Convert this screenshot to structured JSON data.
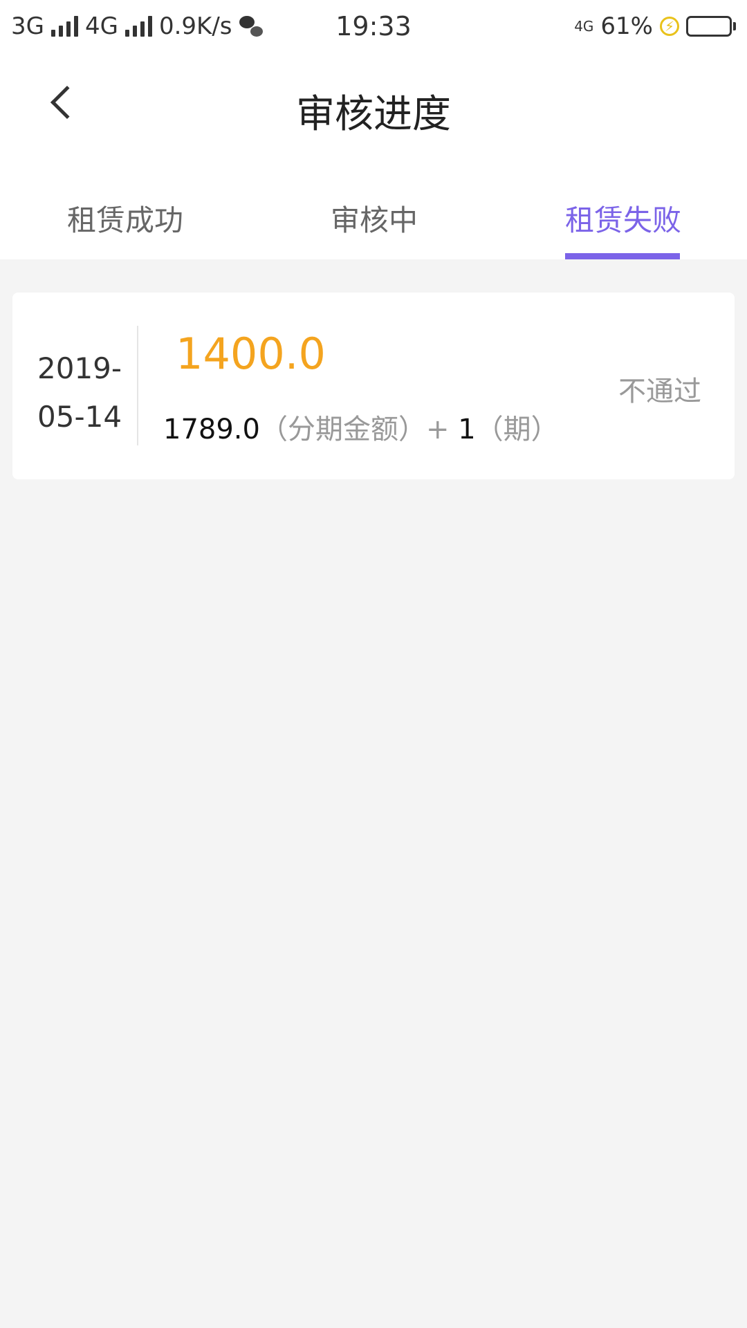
{
  "status_bar": {
    "network1": "3G",
    "network2": "4G",
    "speed": "0.9K/s",
    "time": "19:33",
    "net_small": "4G",
    "battery_pct": "61%",
    "battery_level": 0.61
  },
  "header": {
    "title": "审核进度"
  },
  "tabs": [
    {
      "label": "租赁成功",
      "active": false
    },
    {
      "label": "审核中",
      "active": false
    },
    {
      "label": "租赁失败",
      "active": true
    }
  ],
  "records": [
    {
      "date_line1": "2019-",
      "date_line2": "05-14",
      "amount": "1400.0",
      "installment_amount": "1789.0",
      "installment_label": "（分期金额）+",
      "periods": "1",
      "periods_label": "（期）",
      "status": "不通过"
    }
  ],
  "colors": {
    "accent": "#7b63e8",
    "amount": "#f4a41f",
    "background": "#f4f4f4"
  }
}
